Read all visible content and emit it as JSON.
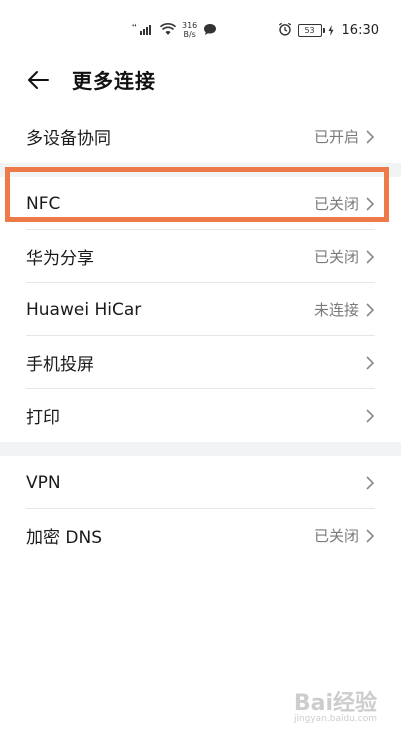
{
  "status_bar": {
    "net_speed_value": "316",
    "net_speed_unit": "B/s",
    "battery": "53",
    "time": "16:30"
  },
  "header": {
    "title": "更多连接"
  },
  "groups": [
    {
      "items": [
        {
          "label": "多设备协同",
          "status": "已开启"
        }
      ]
    },
    {
      "items": [
        {
          "label": "NFC",
          "status": "已关闭"
        },
        {
          "label": "华为分享",
          "status": "已关闭"
        },
        {
          "label": "Huawei HiCar",
          "status": "未连接"
        },
        {
          "label": "手机投屏",
          "status": ""
        },
        {
          "label": "打印",
          "status": ""
        }
      ]
    },
    {
      "items": [
        {
          "label": "VPN",
          "status": ""
        },
        {
          "label": "加密 DNS",
          "status": "已关闭"
        }
      ]
    }
  ],
  "highlight": {
    "target": "NFC",
    "color": "#ee7a4a"
  },
  "watermark": {
    "text": "Bai经验",
    "sub": "jingyan.baidu.com"
  }
}
